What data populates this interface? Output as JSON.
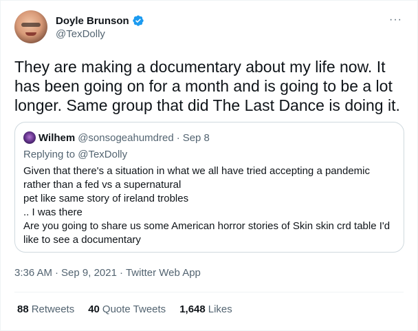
{
  "author": {
    "display_name": "Doyle Brunson",
    "handle": "@TexDolly",
    "verified": true
  },
  "more_menu": "···",
  "tweet_text": "They are making a documentary about my life now. It has been going on for a month and is going to be a lot longer. Same group that did The Last Dance is doing it.",
  "quoted_tweet": {
    "name": "Wilhem",
    "handle": "@sonsogeahumdred",
    "separator": "·",
    "date": "Sep 8",
    "replying_to": "Replying to @TexDolly",
    "text": "Given that there's a situation in what we all have tried accepting a pandemic rather than a fed vs a supernatural\npet like same story of ireland trobles\n..  I was there\nAre you going to share us some American horror stories of Skin skin crd table I'd like to see a documentary"
  },
  "meta": {
    "time": "3:36 AM",
    "separator": "·",
    "date": "Sep 9, 2021",
    "app": "Twitter Web App"
  },
  "stats": {
    "retweets_count": "88",
    "retweets_label": "Retweets",
    "quotes_count": "40",
    "quotes_label": "Quote Tweets",
    "likes_count": "1,648",
    "likes_label": "Likes"
  },
  "colors": {
    "verified": "#1d9bf0",
    "secondary_text": "#536471",
    "primary_text": "#0f1419",
    "border": "#cfd9de"
  }
}
